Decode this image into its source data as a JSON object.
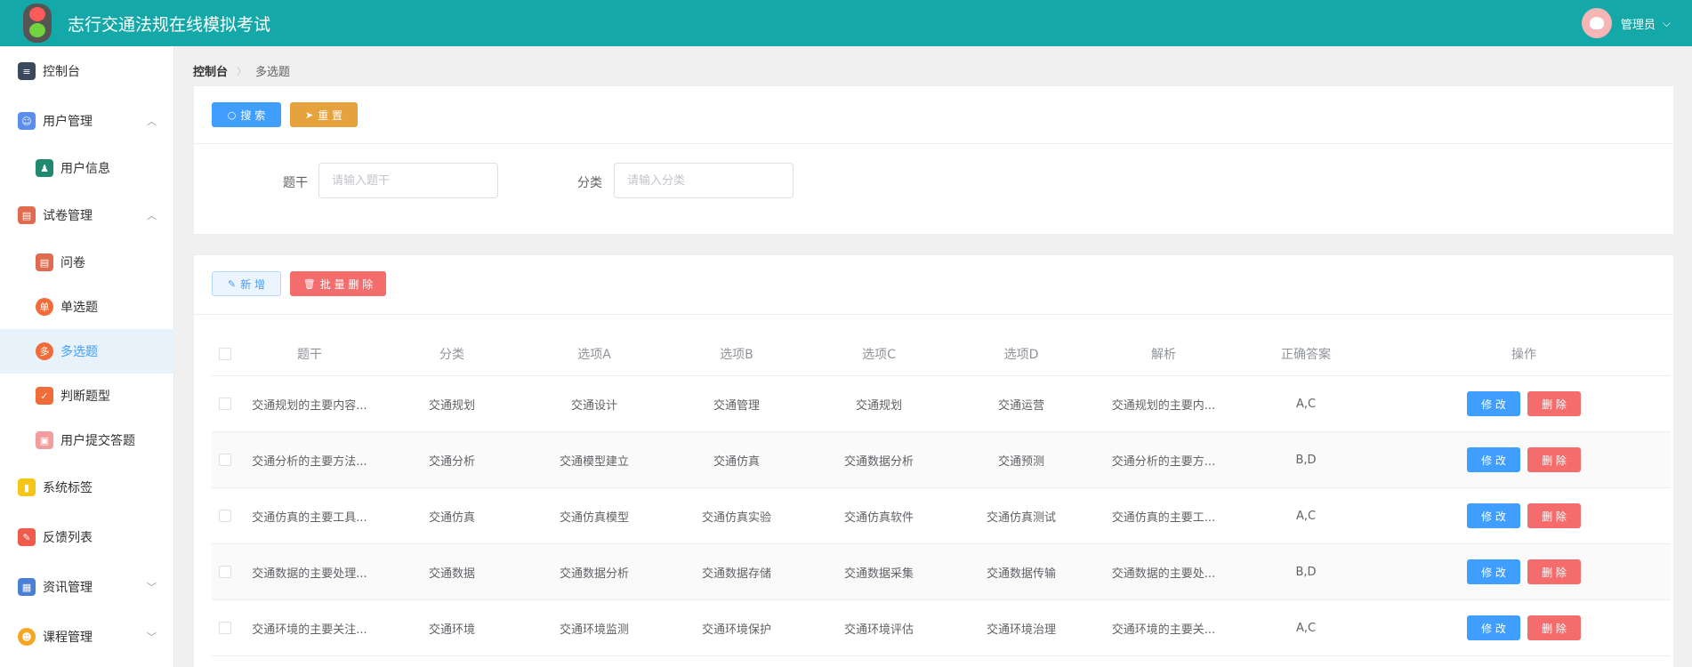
{
  "header": {
    "app_title": "志行交通法规在线模拟考试",
    "user_name": "管理员"
  },
  "sidebar": {
    "items": [
      {
        "label": "控制台",
        "icon": "dashboard-icon",
        "color": "#3a4a5c"
      },
      {
        "label": "用户管理",
        "icon": "user-management-icon",
        "color": "#5b8def",
        "expanded": true
      },
      {
        "label": "用户信息",
        "icon": "user-info-icon",
        "color": "#1f8a70"
      },
      {
        "label": "试卷管理",
        "icon": "exam-paper-icon",
        "color": "#e06b4f",
        "expanded": true
      },
      {
        "label": "问卷",
        "icon": "questionnaire-icon",
        "color": "#e06b4f"
      },
      {
        "label": "单选题",
        "icon": "single-choice-icon",
        "color": "#f26c3a",
        "badge": "单"
      },
      {
        "label": "多选题",
        "icon": "multi-choice-icon",
        "color": "#f26c3a",
        "badge": "多",
        "active": true
      },
      {
        "label": "判断题型",
        "icon": "true-false-icon",
        "color": "#f26c3a"
      },
      {
        "label": "用户提交答题",
        "icon": "submission-icon",
        "color": "#f39c9c"
      },
      {
        "label": "系统标签",
        "icon": "tag-icon",
        "color": "#f5c518"
      },
      {
        "label": "反馈列表",
        "icon": "feedback-icon",
        "color": "#f05a4a"
      },
      {
        "label": "资讯管理",
        "icon": "news-icon",
        "color": "#4a7fd6",
        "expanded": false
      },
      {
        "label": "课程管理",
        "icon": "course-icon",
        "color": "#f5a623",
        "expanded": false
      }
    ]
  },
  "breadcrumb": {
    "home": "控制台",
    "current": "多选题"
  },
  "search_panel": {
    "search_label": "搜 索",
    "reset_label": "重 置",
    "field1_label": "题干",
    "field1_placeholder": "请输入题干",
    "field2_label": "分类",
    "field2_placeholder": "请输入分类"
  },
  "table_panel": {
    "add_label": "新 增",
    "batch_delete_label": "批 量 删 除",
    "edit_label": "修 改",
    "delete_label": "删 除",
    "columns": [
      "题干",
      "分类",
      "选项A",
      "选项B",
      "选项C",
      "选项D",
      "解析",
      "正确答案",
      "操作"
    ],
    "rows": [
      [
        "交通规划的主要内容...",
        "交通规划",
        "交通设计",
        "交通管理",
        "交通规划",
        "交通运营",
        "交通规划的主要内...",
        "A,C"
      ],
      [
        "交通分析的主要方法...",
        "交通分析",
        "交通模型建立",
        "交通仿真",
        "交通数据分析",
        "交通预测",
        "交通分析的主要方...",
        "B,D"
      ],
      [
        "交通仿真的主要工具...",
        "交通仿真",
        "交通仿真模型",
        "交通仿真实验",
        "交通仿真软件",
        "交通仿真测试",
        "交通仿真的主要工...",
        "A,C"
      ],
      [
        "交通数据的主要处理...",
        "交通数据",
        "交通数据分析",
        "交通数据存储",
        "交通数据采集",
        "交通数据传输",
        "交通数据的主要处...",
        "B,D"
      ],
      [
        "交通环境的主要关注...",
        "交通环境",
        "交通环境监测",
        "交通环境保护",
        "交通环境评估",
        "交通环境治理",
        "交通环境的主要关...",
        "A,C"
      ]
    ]
  },
  "colors": {
    "header": "#14a8a8",
    "primary": "#409eff",
    "warning": "#e6a23c",
    "danger": "#f56c6c",
    "active_bg": "#e7f2fb"
  }
}
